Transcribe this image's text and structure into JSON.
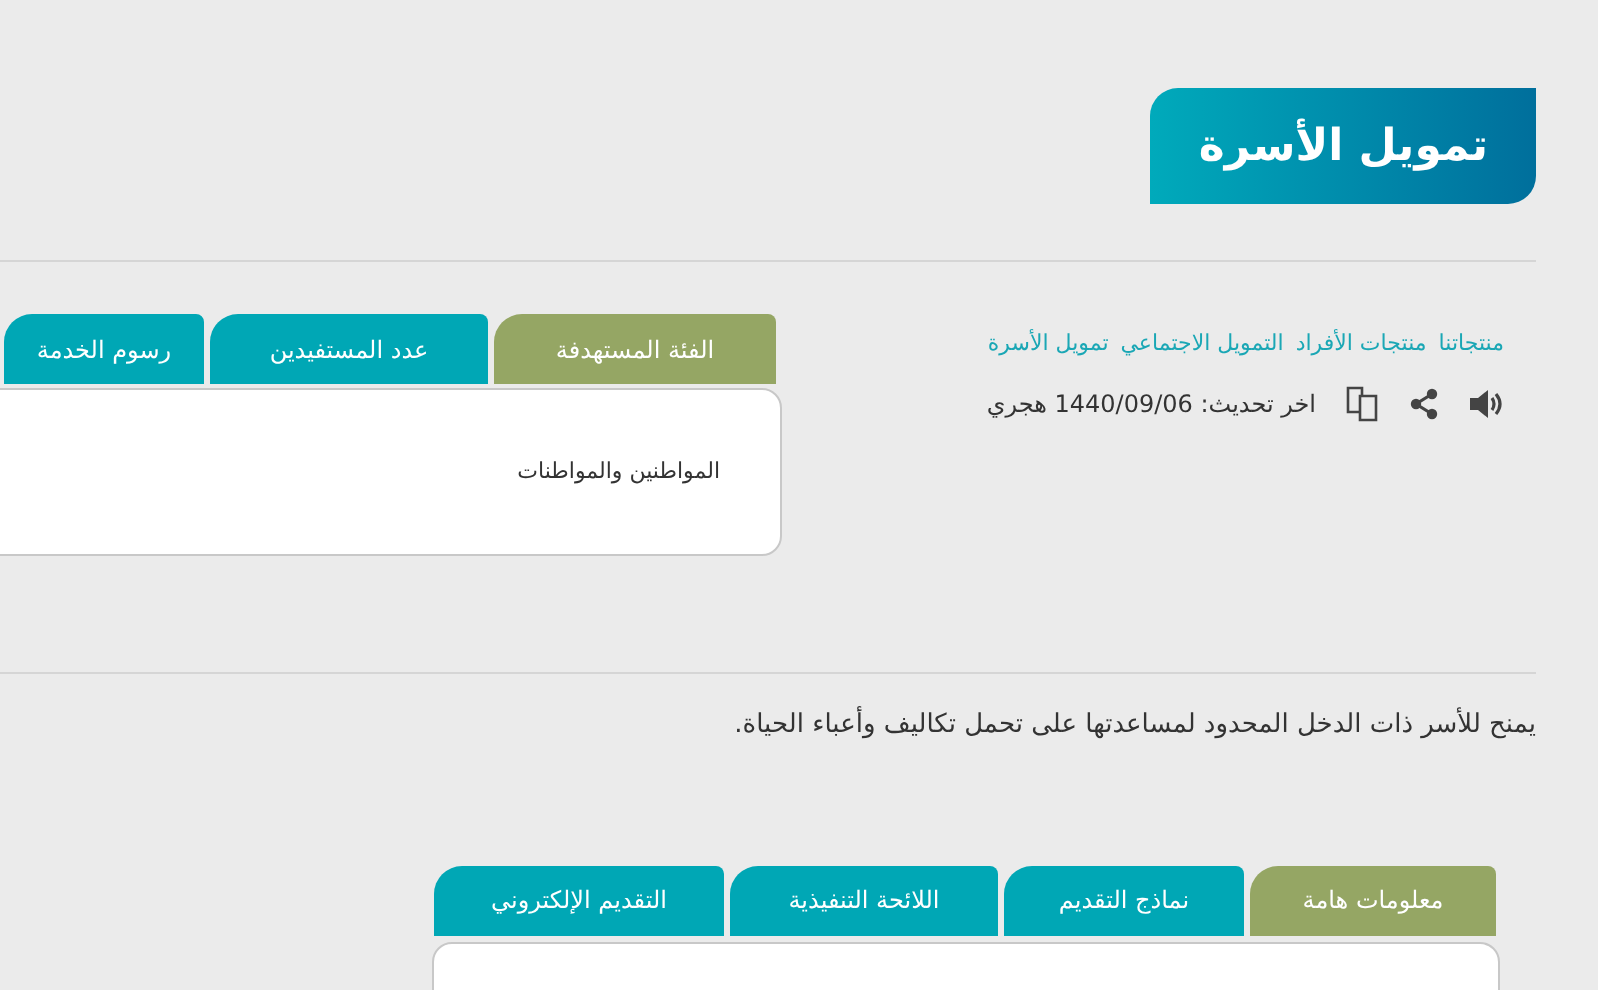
{
  "title": "تمويل الأسرة",
  "breadcrumb": [
    "منتجاتنا",
    "منتجات الأفراد",
    "التمويل الاجتماعي",
    "تمويل الأسرة"
  ],
  "last_update": "اخر تحديث: 1440/09/06 هجري",
  "info_tabs": [
    {
      "label": "الفئة المستهدفة",
      "selected": true
    },
    {
      "label": "عدد المستفيدين",
      "selected": false
    },
    {
      "label": "رسوم الخدمة",
      "selected": false
    }
  ],
  "info_content": "المواطنين والمواطنات",
  "description": "يمنح للأسر ذات الدخل المحدود لمساعدتها على تحمل تكاليف وأعباء الحياة.",
  "detail_tabs": [
    {
      "label": "معلومات هامة",
      "selected": true
    },
    {
      "label": "نماذج التقديم",
      "selected": false
    },
    {
      "label": "اللائحة التنفيذية",
      "selected": false
    },
    {
      "label": "التقديم الإلكتروني",
      "selected": false
    }
  ]
}
